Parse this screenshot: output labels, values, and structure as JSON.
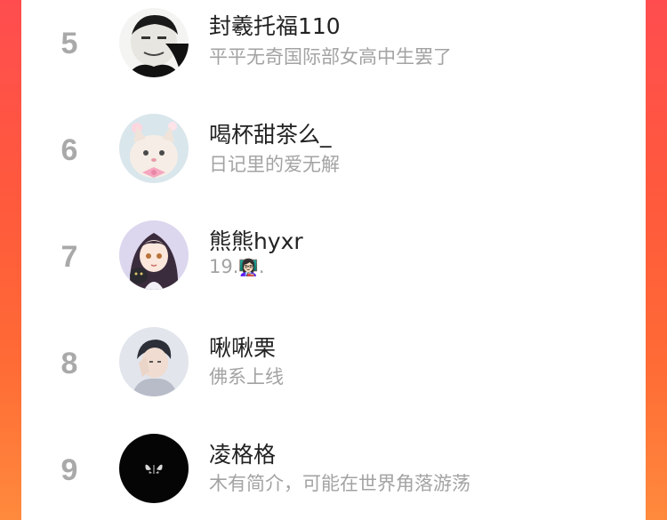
{
  "ranking": {
    "items": [
      {
        "rank": "5",
        "name": "封羲托福110",
        "bio": "平平无奇国际部女高中生罢了",
        "avatar": "meme-face-avatar"
      },
      {
        "rank": "6",
        "name": "喝杯甜茶么_",
        "bio": "日记里的爱无解",
        "avatar": "cat-avatar"
      },
      {
        "rank": "7",
        "name": "熊熊hyxr",
        "bio_prefix": "19.",
        "bio_emoji": "👩🏻‍🏫",
        "bio_suffix": ".",
        "avatar": "anime-girl-avatar"
      },
      {
        "rank": "8",
        "name": "啾啾栗",
        "bio": "佛系上线",
        "avatar": "man-portrait-avatar"
      },
      {
        "rank": "9",
        "name": "凌格格",
        "bio": "木有简介，可能在世界角落游荡",
        "avatar": "black-butterfly-avatar"
      }
    ]
  },
  "colors": {
    "side_gradient_top": "#ff4d4f",
    "side_gradient_bottom": "#ff8a3d",
    "rank_number": "#a9a9a9",
    "name_text": "#222222",
    "bio_text": "#a3a3a3"
  }
}
